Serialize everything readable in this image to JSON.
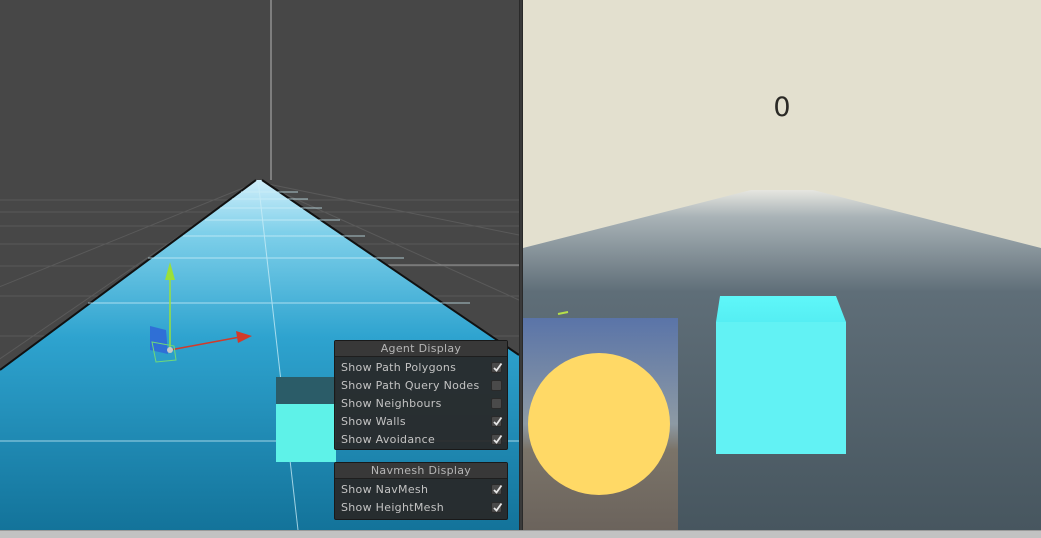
{
  "scene_view": {
    "agent_display": {
      "title": "Agent Display",
      "toggles": [
        {
          "label": "Show Path Polygons",
          "checked": true
        },
        {
          "label": "Show Path Query Nodes",
          "checked": false
        },
        {
          "label": "Show Neighbours",
          "checked": false
        },
        {
          "label": "Show Walls",
          "checked": true
        },
        {
          "label": "Show Avoidance",
          "checked": true
        }
      ]
    },
    "navmesh_display": {
      "title": "Navmesh Display",
      "toggles": [
        {
          "label": "Show NavMesh",
          "checked": true
        },
        {
          "label": "Show HeightMesh",
          "checked": true
        }
      ]
    },
    "gizmo": {
      "y_axis_color": "#9be03a",
      "x_axis_color": "#d23a2a",
      "z_axis_color": "#2f6fd6"
    },
    "colors": {
      "background": "#474747",
      "navmesh": "#2aa6cf",
      "cube": "#5ef2e8"
    }
  },
  "game_view": {
    "score": "0",
    "colors": {
      "sky": "#e3e0cf",
      "ground": "#55656f",
      "cube": "#62f2f4",
      "sphere": "#ffd966"
    }
  }
}
